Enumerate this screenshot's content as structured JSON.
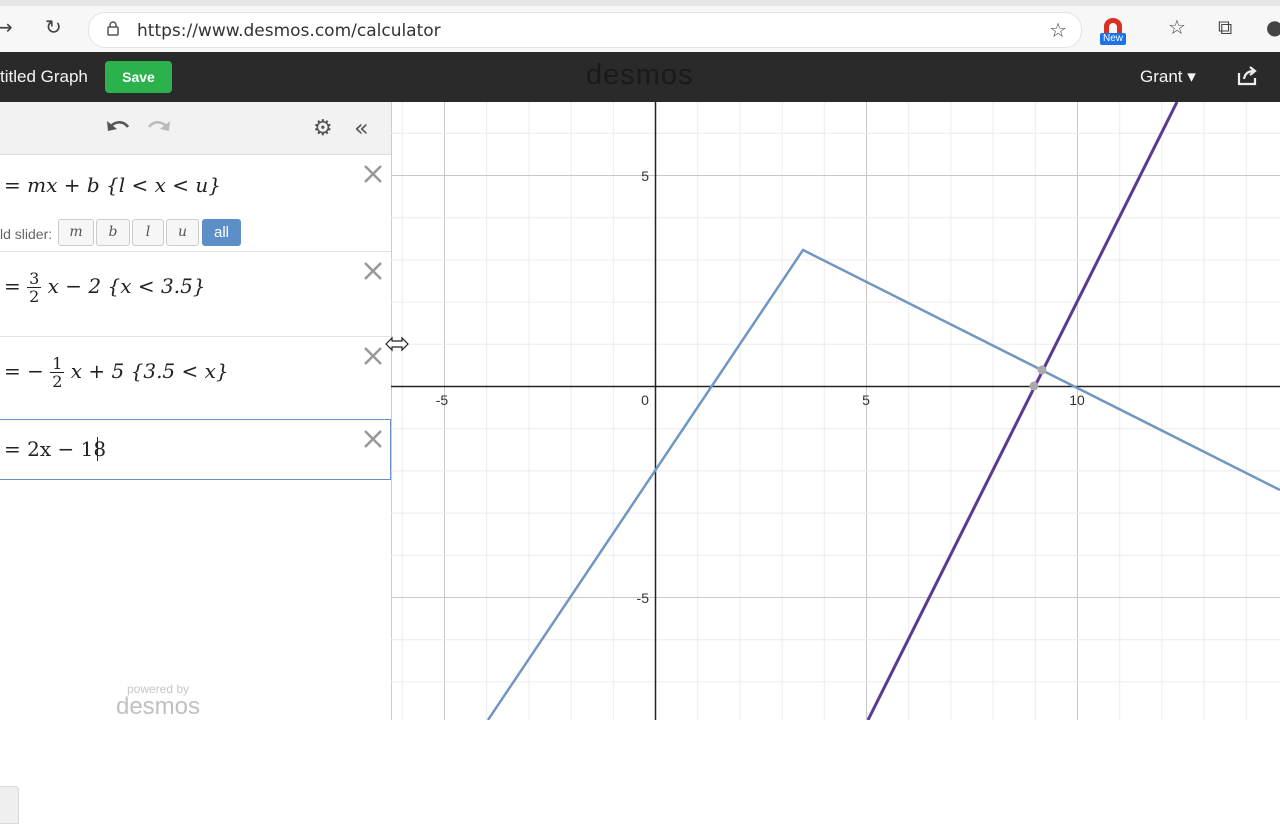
{
  "browser": {
    "url": "https://www.desmos.com/calculator",
    "extension_badge": "New"
  },
  "header": {
    "title": "titled Graph",
    "save_label": "Save",
    "logo": "desmos",
    "user": "Grant ▾"
  },
  "expressions": {
    "items": [
      {
        "latex": "= mx + b {l < x < u}"
      },
      {
        "latex": "= 3/2 x − 2 {x < 3.5}",
        "num": "3",
        "den": "2",
        "rest": "x − 2 {x < 3.5}",
        "prefix": "="
      },
      {
        "latex": "= −1/2 x + 5 {3.5 < x}",
        "num": "1",
        "den": "2",
        "rest": "x + 5 {3.5 < x}",
        "prefix": "= −"
      },
      {
        "latex": "= 2x − 18"
      }
    ],
    "slider_label": "ld slider:",
    "slider_buttons": [
      "m",
      "b",
      "l",
      "u",
      "all"
    ]
  },
  "powered_by": {
    "small": "powered by",
    "logo": "desmos"
  },
  "graph": {
    "x_ticks": [
      "-5",
      "0",
      "5",
      "10"
    ],
    "y_ticks": [
      "5",
      "-5"
    ],
    "line_color_1": "#6f97c2",
    "line_color_2": "#5b3a96"
  }
}
